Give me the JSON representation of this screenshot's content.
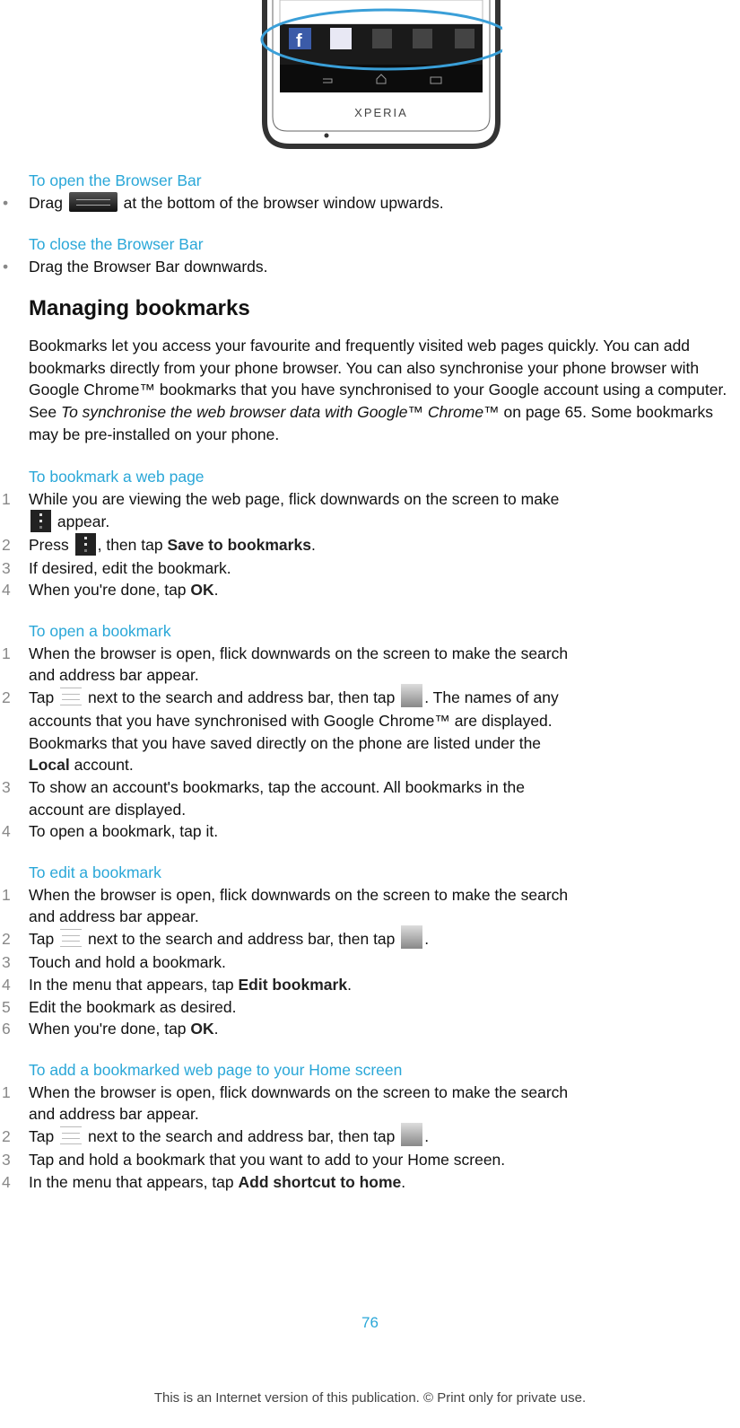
{
  "phone_image": {
    "brand": "XPERIA",
    "bar_icons": [
      "facebook-icon",
      "calendar-icon",
      "share-icon",
      "photo-icon",
      "album-icon"
    ]
  },
  "sections": [
    {
      "type": "task",
      "heading": "To open the Browser Bar",
      "list": "bullet",
      "items": [
        [
          {
            "t": "Drag "
          },
          {
            "i": "handle"
          },
          {
            "t": " at the bottom of the browser window upwards."
          }
        ]
      ]
    },
    {
      "type": "task",
      "heading": "To close the Browser Bar",
      "list": "bullet",
      "items": [
        [
          {
            "t": "Drag the Browser Bar downwards."
          }
        ]
      ]
    },
    {
      "type": "title",
      "text": "Managing bookmarks"
    },
    {
      "type": "para",
      "segments": [
        {
          "t": "Bookmarks let you access your favourite and frequently visited web pages quickly. You can add bookmarks directly from your phone browser. You can also synchronise your phone browser with Google Chrome™ bookmarks that you have synchronised to your Google account using a computer. See "
        },
        {
          "em": "To synchronise the web browser data with Google™ Chrome™"
        },
        {
          "t": " on page 65. Some bookmarks may be pre-installed on your phone."
        }
      ]
    },
    {
      "type": "task",
      "heading": "To bookmark a web page",
      "list": "number",
      "items": [
        [
          {
            "t": "While you are viewing the web page, flick downwards on the screen to make"
          },
          {
            "br": 1
          },
          {
            "i": "menu"
          },
          {
            "t": " appear."
          }
        ],
        [
          {
            "t": "Press "
          },
          {
            "i": "menu"
          },
          {
            "t": ", then tap "
          },
          {
            "b": "Save to bookmarks"
          },
          {
            "t": "."
          }
        ],
        [
          {
            "t": "If desired, edit the bookmark."
          }
        ],
        [
          {
            "t": "When you're done, tap "
          },
          {
            "b": "OK"
          },
          {
            "t": "."
          }
        ]
      ]
    },
    {
      "type": "task",
      "heading": "To open a bookmark",
      "list": "number",
      "items": [
        [
          {
            "t": "When the browser is open, flick downwards on the screen to make the search"
          },
          {
            "br": 1
          },
          {
            "t": "and address bar appear."
          }
        ],
        [
          {
            "t": "Tap "
          },
          {
            "i": "tabs"
          },
          {
            "t": " next to the search and address bar, then tap "
          },
          {
            "i": "star"
          },
          {
            "t": ". The names of any"
          },
          {
            "br": 1
          },
          {
            "t": "accounts that you have synchronised with Google Chrome™ are displayed."
          },
          {
            "br": 1
          },
          {
            "t": "Bookmarks that you have saved directly on the phone are listed under the"
          },
          {
            "br": 1
          },
          {
            "b": "Local"
          },
          {
            "t": " account."
          }
        ],
        [
          {
            "t": "To show an account's bookmarks, tap the account. All bookmarks in the"
          },
          {
            "br": 1
          },
          {
            "t": "account are displayed."
          }
        ],
        [
          {
            "t": "To open a bookmark, tap it."
          }
        ]
      ]
    },
    {
      "type": "task",
      "heading": "To edit a bookmark",
      "list": "number",
      "items": [
        [
          {
            "t": "When the browser is open, flick downwards on the screen to make the search"
          },
          {
            "br": 1
          },
          {
            "t": "and address bar appear."
          }
        ],
        [
          {
            "t": "Tap "
          },
          {
            "i": "tabs"
          },
          {
            "t": " next to the search and address bar, then tap "
          },
          {
            "i": "star"
          },
          {
            "t": "."
          }
        ],
        [
          {
            "t": "Touch and hold a bookmark."
          }
        ],
        [
          {
            "t": "In the menu that appears, tap "
          },
          {
            "b": "Edit bookmark"
          },
          {
            "t": "."
          }
        ],
        [
          {
            "t": "Edit the bookmark as desired."
          }
        ],
        [
          {
            "t": "When you're done, tap "
          },
          {
            "b": "OK"
          },
          {
            "t": "."
          }
        ]
      ]
    },
    {
      "type": "task",
      "heading": "To add a bookmarked web page to your Home screen",
      "list": "number",
      "items": [
        [
          {
            "t": "When the browser is open, flick downwards on the screen to make the search"
          },
          {
            "br": 1
          },
          {
            "t": "and address bar appear."
          }
        ],
        [
          {
            "t": "Tap "
          },
          {
            "i": "tabs"
          },
          {
            "t": " next to the search and address bar, then tap "
          },
          {
            "i": "star"
          },
          {
            "t": "."
          }
        ],
        [
          {
            "t": "Tap and hold a bookmark that you want to add to your Home screen."
          }
        ],
        [
          {
            "t": "In the menu that appears, tap "
          },
          {
            "b": "Add shortcut to home"
          },
          {
            "t": "."
          }
        ]
      ]
    }
  ],
  "footer": {
    "page_number": "76",
    "notice": "This is an Internet version of this publication. © Print only for private use."
  },
  "colors": {
    "heading": "#2aa7d8",
    "highlight_ellipse": "#3a9fd8"
  }
}
